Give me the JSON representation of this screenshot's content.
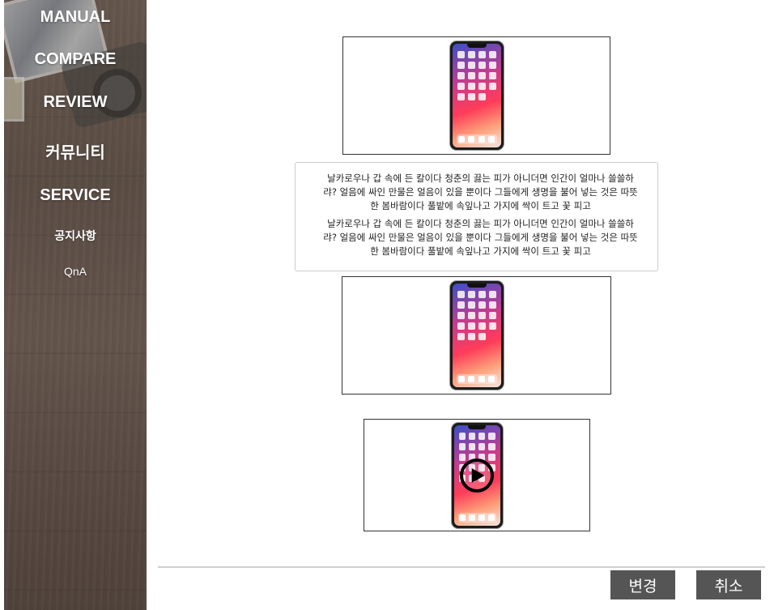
{
  "sidebar": {
    "items": [
      {
        "label": "MANUAL"
      },
      {
        "label": "COMPARE"
      },
      {
        "label": "REVIEW"
      },
      {
        "label": "커뮤니티"
      },
      {
        "label": "SERVICE"
      },
      {
        "label": "공지사항"
      },
      {
        "label": "QnA"
      }
    ]
  },
  "content": {
    "paragraph_1": "날카로우나 갑 속에 든 칼이다 청춘의 끓는 피가 아니더면 인간이 얼마나 쓸쓸하랴? 얼음에 싸인 만물은 얼음이 있을 뿐이다 그들에게 생명을 불어 넣는 것은 따뜻한 봄바람이다 풀밭에 속잎나고 가지에 싹이 트고 꽃 피고",
    "paragraph_2": "날카로우나 갑 속에 든 칼이다 청춘의 끓는 피가 아니더면 인간이 얼마나 쓸쓸하랴? 얼음에 싸인 만물은 얼음이 있을 뿐이다 그들에게 생명을 불어 넣는 것은 따뜻한 봄바람이다 풀밭에 속잎나고 가지에 싹이 트고 꽃 피고",
    "images": [
      {
        "icon": "phone-image"
      },
      {
        "icon": "phone-image"
      },
      {
        "icon": "phone-video-thumbnail"
      }
    ]
  },
  "actions": {
    "change_label": "변경",
    "cancel_label": "취소"
  },
  "colors": {
    "button_bg": "#555555",
    "divider": "#cfcfcf"
  }
}
